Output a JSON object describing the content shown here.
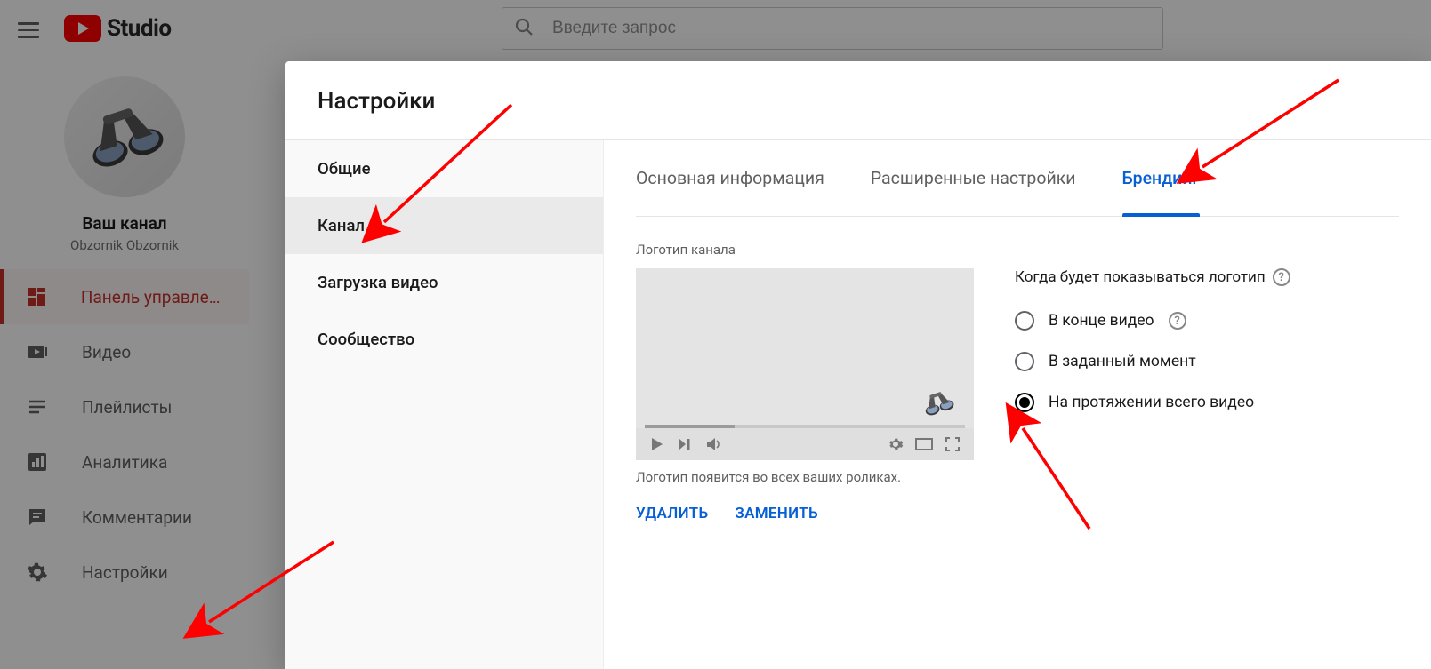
{
  "header": {
    "logo_text": "Studio",
    "search_placeholder": "Введите запрос"
  },
  "sidebar": {
    "channel_label": "Ваш канал",
    "channel_name": "Obzornik Obzornik",
    "items": [
      {
        "label": "Панель управлен…",
        "icon": "dashboard",
        "active": true
      },
      {
        "label": "Видео",
        "icon": "videos",
        "active": false
      },
      {
        "label": "Плейлисты",
        "icon": "playlists",
        "active": false
      },
      {
        "label": "Аналитика",
        "icon": "analytics",
        "active": false
      },
      {
        "label": "Комментарии",
        "icon": "comments",
        "active": false
      },
      {
        "label": "Настройки",
        "icon": "settings",
        "active": false
      }
    ]
  },
  "dialog": {
    "title": "Настройки",
    "nav": [
      {
        "label": "Общие",
        "selected": false
      },
      {
        "label": "Канал",
        "selected": true
      },
      {
        "label": "Загрузка видео",
        "selected": false
      },
      {
        "label": "Сообщество",
        "selected": false
      }
    ],
    "tabs": [
      {
        "label": "Основная информация",
        "active": false
      },
      {
        "label": "Расширенные настройки",
        "active": false
      },
      {
        "label": "Брендинг",
        "active": true
      }
    ],
    "branding": {
      "section_label": "Логотип канала",
      "caption": "Логотип появится во всех ваших роликах.",
      "btn_delete": "УДАЛИТЬ",
      "btn_replace": "ЗАМЕНИТЬ",
      "timing_label": "Когда будет показываться логотип",
      "options": [
        {
          "label": "В конце видео",
          "help": true,
          "checked": false
        },
        {
          "label": "В заданный момент",
          "help": false,
          "checked": false
        },
        {
          "label": "На протяжении всего видео",
          "help": false,
          "checked": true
        }
      ]
    }
  }
}
